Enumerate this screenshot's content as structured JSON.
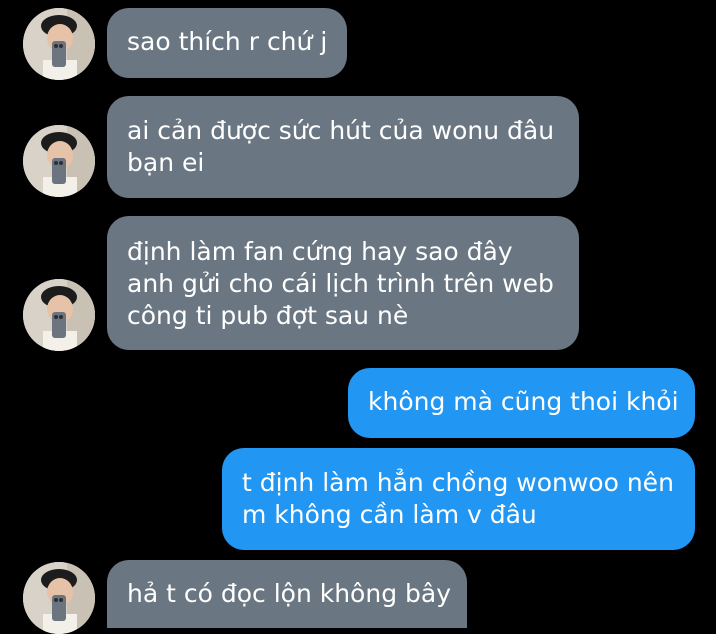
{
  "chat": {
    "messages": [
      {
        "sender": "other",
        "lines": [
          "sao thích r chứ j"
        ]
      },
      {
        "sender": "other",
        "lines": [
          "ai cản được sức hút của wonu đâu",
          "bạn ei"
        ]
      },
      {
        "sender": "other",
        "lines": [
          "định làm fan cứng hay sao đây",
          "anh gửi cho cái lịch trình trên web",
          "công ti pub đợt sau nè"
        ]
      },
      {
        "sender": "me",
        "lines": [
          "không mà cũng thoi khỏi"
        ]
      },
      {
        "sender": "me",
        "lines": [
          "t định làm hẳn chồng wonwoo nên",
          "m không cần làm v đâu"
        ]
      },
      {
        "sender": "other",
        "lines": [
          "hả t có đọc lộn không bây"
        ]
      }
    ]
  },
  "colors": {
    "background": "#000000",
    "incoming_bubble": "#6a7682",
    "outgoing_bubble": "#2196f3",
    "text": "#ffffff"
  },
  "icons": {
    "avatar": "contact-avatar-icon"
  }
}
